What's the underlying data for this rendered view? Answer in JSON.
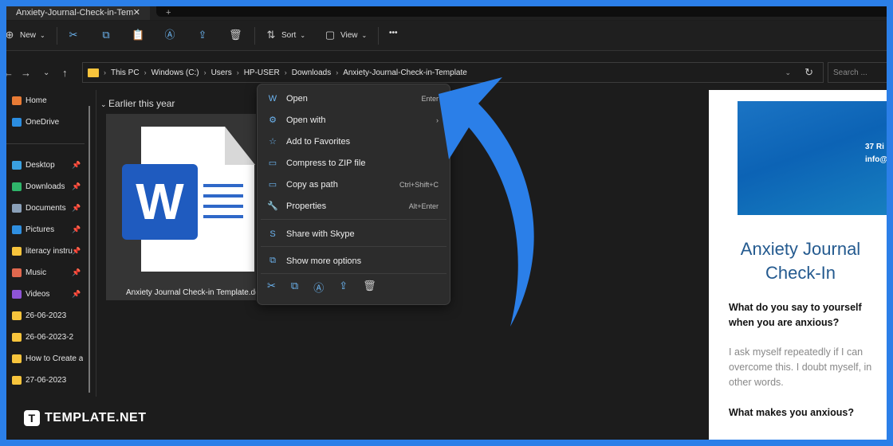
{
  "window": {
    "tab_title": "Anxiety-Journal-Check-in-Tem",
    "tab_close": "✕",
    "new_tab": "+"
  },
  "toolbar": {
    "new_label": "New",
    "sort_label": "Sort",
    "view_label": "View",
    "more": "•••"
  },
  "address": {
    "crumbs": [
      "This PC",
      "Windows (C:)",
      "Users",
      "HP-USER",
      "Downloads",
      "Anxiety-Journal-Check-in-Template"
    ],
    "search_placeholder": "Search ..."
  },
  "sidebar": {
    "items": [
      {
        "label": "Home",
        "color": "#e87b35"
      },
      {
        "label": "OneDrive",
        "color": "#2b8de0"
      },
      {
        "label": "Desktop",
        "color": "#3aa0e0",
        "pinned": true
      },
      {
        "label": "Downloads",
        "color": "#2fb56a",
        "pinned": true
      },
      {
        "label": "Documents",
        "color": "#8aa0b8",
        "pinned": true
      },
      {
        "label": "Pictures",
        "color": "#2f8fe0",
        "pinned": true
      },
      {
        "label": "literacy instru",
        "color": "#f7c43c",
        "pinned": true
      },
      {
        "label": "Music",
        "color": "#e0684e",
        "pinned": true
      },
      {
        "label": "Videos",
        "color": "#8e54d6",
        "pinned": true
      },
      {
        "label": "26-06-2023",
        "color": "#f7c43c"
      },
      {
        "label": "26-06-2023-2",
        "color": "#f7c43c"
      },
      {
        "label": "How to Create a",
        "color": "#f7c43c"
      },
      {
        "label": "27-06-2023",
        "color": "#f7c43c"
      }
    ]
  },
  "content": {
    "group_label": "Earlier this year",
    "file_name": "Anxiety Journal Check-in Template.docx",
    "word_letter": "W"
  },
  "context_menu": {
    "items": [
      {
        "label": "Open",
        "shortcut": "Enter",
        "icon": "word-icon"
      },
      {
        "label": "Open with",
        "shortcut": "›",
        "icon": "open-with-icon"
      },
      {
        "label": "Add to Favorites",
        "shortcut": "",
        "icon": "star-icon"
      },
      {
        "label": "Compress to ZIP file",
        "shortcut": "",
        "icon": "zip-icon"
      },
      {
        "label": "Copy as path",
        "shortcut": "Ctrl+Shift+C",
        "icon": "path-icon"
      },
      {
        "label": "Properties",
        "shortcut": "Alt+Enter",
        "icon": "wrench-icon"
      },
      {
        "label": "Share with Skype",
        "shortcut": "",
        "icon": "skype-icon"
      },
      {
        "label": "Show more options",
        "shortcut": "",
        "icon": "more-options-icon"
      }
    ]
  },
  "preview": {
    "banner_line1": "37 Ri",
    "banner_line2": "info@",
    "title": "Anxiety Journal Check-In",
    "q1": "What do you say to yourself when you are anxious?",
    "a1": "I ask myself repeatedly if I can overcome this. I doubt myself, in other words.",
    "q2": "What makes you anxious?"
  },
  "brand": {
    "logo_letter": "T",
    "name": "TEMPLATE.NET"
  },
  "colors": {
    "accent": "#2b7fe8",
    "title": "#245a8f"
  }
}
